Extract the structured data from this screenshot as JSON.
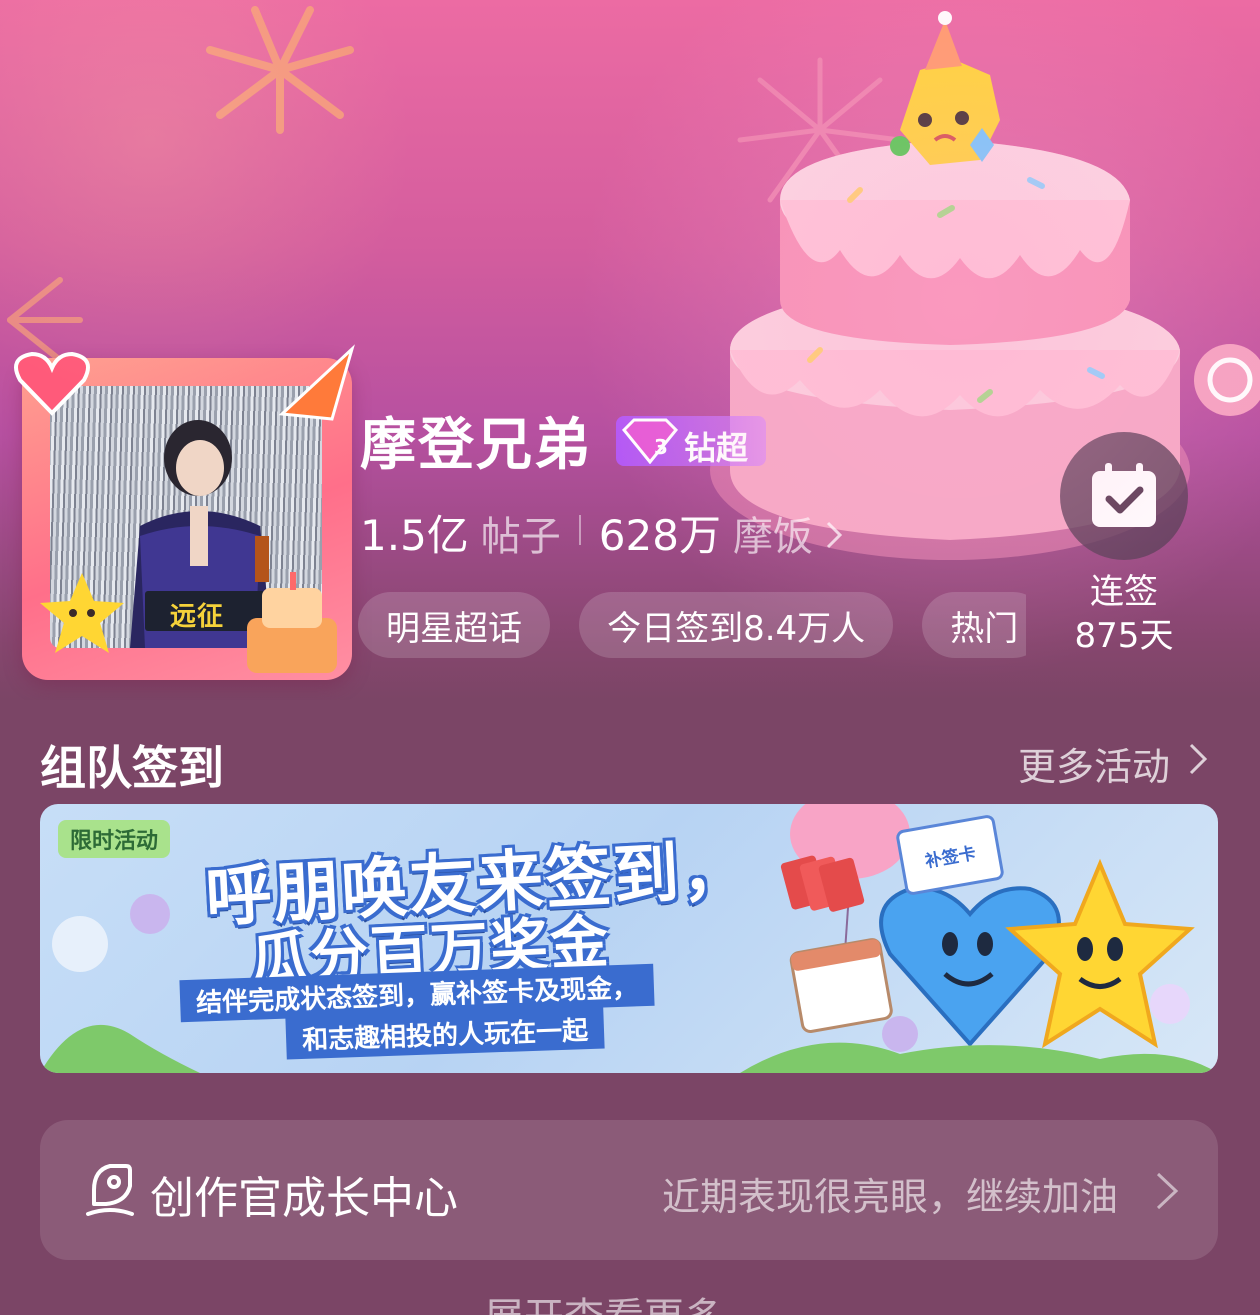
{
  "header": {
    "supertopic_name": "摩登兄弟",
    "badge_level": "3",
    "badge_label": "钻超",
    "posts_count": "1.5亿",
    "posts_unit": "帖子",
    "fans_count": "628万",
    "fans_unit": "摩饭",
    "chips": [
      "明星超话",
      "今日签到8.4万人",
      "热门"
    ],
    "avatar_clap_text": "远征"
  },
  "signin": {
    "label_line1": "连签",
    "label_line2": "875天"
  },
  "team_signin": {
    "title": "组队签到",
    "more_label": "更多活动",
    "promo": {
      "tag": "限时活动",
      "headline1": "呼朋唤友来签到，",
      "headline2": "瓜分百万奖金",
      "sub1": "结伴完成状态签到，赢补签卡及现金，",
      "sub2": "和志趣相投的人玩在一起",
      "card_label": "补签卡"
    }
  },
  "creator_center": {
    "title": "创作官成长中心",
    "hint": "近期表现很亮眼，继续加油"
  },
  "footer": {
    "partial_text": "展开查看更多"
  },
  "colors": {
    "page_bg": "#7b4566",
    "banner_top": "#ec6ba3",
    "accent_blue": "#3a6ccf",
    "badge_purple": "#b45aff"
  }
}
